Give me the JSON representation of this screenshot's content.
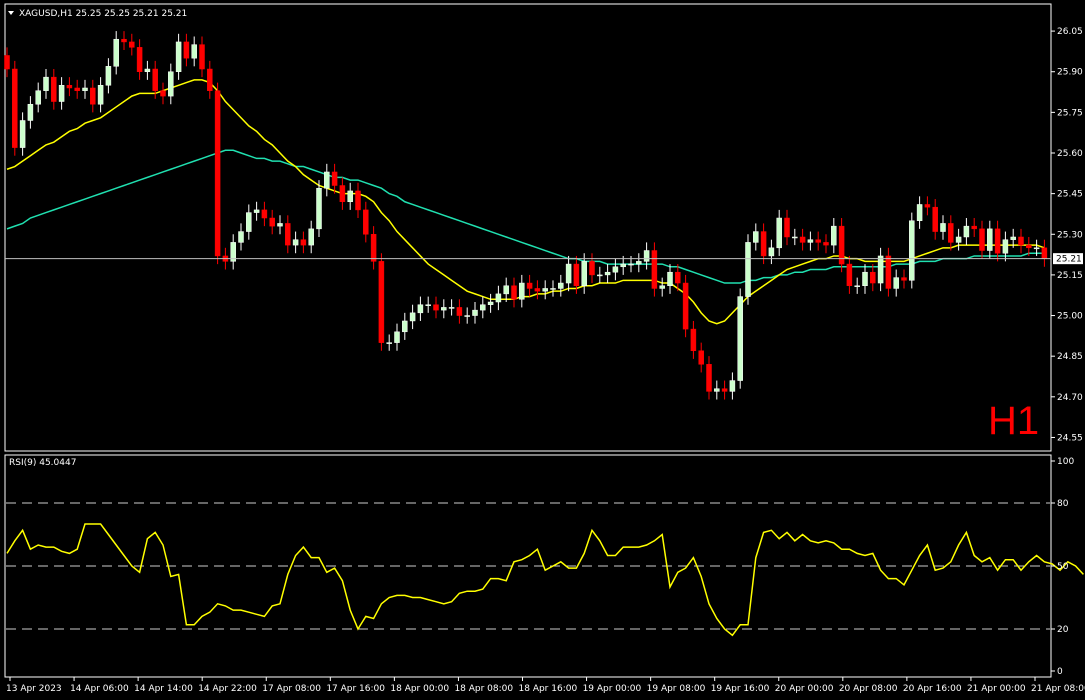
{
  "header": {
    "symbol_line": "XAGUSD,H1  25.25 25.25 25.21 25.21",
    "timeframe_label": "H1",
    "current_price_label": "25.21"
  },
  "colors": {
    "background": "#000000",
    "grid": "#ffffff",
    "bull_candle": "#ffffff",
    "bull_candle_fill": "#ccffcc",
    "bear_candle": "#ff0000",
    "fast_ma": "#ffff00",
    "slow_ma": "#20e0b0",
    "rsi_line": "#ffff00",
    "timeframe_text": "#ff0000"
  },
  "chart_data": [
    {
      "type": "candlestick",
      "symbol": "XAGUSD",
      "timeframe": "H1",
      "ylim": [
        24.5,
        26.15
      ],
      "y_ticks": [
        "26.05",
        "25.90",
        "25.75",
        "25.60",
        "25.45",
        "25.30",
        "25.15",
        "25.00",
        "24.85",
        "24.70",
        "24.55"
      ],
      "last_price": 25.21,
      "x_tick_labels": [
        "13 Apr 2023",
        "14 Apr 06:00",
        "14 Apr 14:00",
        "14 Apr 22:00",
        "17 Apr 08:00",
        "17 Apr 16:00",
        "18 Apr 00:00",
        "18 Apr 08:00",
        "18 Apr 16:00",
        "19 Apr 00:00",
        "19 Apr 08:00",
        "19 Apr 16:00",
        "20 Apr 00:00",
        "20 Apr 08:00",
        "20 Apr 16:00",
        "21 Apr 00:00",
        "21 Apr 08:00"
      ],
      "close": [
        25.91,
        25.62,
        25.72,
        25.78,
        25.83,
        25.88,
        25.79,
        25.85,
        25.84,
        25.83,
        25.84,
        25.78,
        25.85,
        25.92,
        26.02,
        26.01,
        25.99,
        25.9,
        25.91,
        25.83,
        25.81,
        25.9,
        26.01,
        25.95,
        26.0,
        25.91,
        25.83,
        25.22,
        25.2,
        25.27,
        25.31,
        25.38,
        25.39,
        25.36,
        25.33,
        25.34,
        25.26,
        25.28,
        25.26,
        25.32,
        25.47,
        25.53,
        25.48,
        25.42,
        25.46,
        25.39,
        25.3,
        25.2,
        24.9,
        24.9,
        24.94,
        24.98,
        25.01,
        25.04,
        25.04,
        25.02,
        25.03,
        25.03,
        25.0,
        25.0,
        25.02,
        25.04,
        25.05,
        25.08,
        25.11,
        25.06,
        25.12,
        25.1,
        25.09,
        25.1,
        25.1,
        25.12,
        25.19,
        25.11,
        25.2,
        25.15,
        25.15,
        25.16,
        25.18,
        25.19,
        25.19,
        25.2,
        25.24,
        25.1,
        25.11,
        25.16,
        25.12,
        24.95,
        24.87,
        24.82,
        24.72,
        24.73,
        24.72,
        24.76,
        25.07,
        25.27,
        25.31,
        25.22,
        25.25,
        25.36,
        25.29,
        25.29,
        25.27,
        25.28,
        25.27,
        25.26,
        25.33,
        25.19,
        25.11,
        25.11,
        25.16,
        25.12,
        25.22,
        25.1,
        25.14,
        25.13,
        25.35,
        25.41,
        25.4,
        25.31,
        25.34,
        25.27,
        25.29,
        25.33,
        25.32,
        25.24,
        25.32,
        25.23,
        25.28,
        25.29,
        25.26,
        25.25,
        25.25,
        25.21
      ],
      "series": [
        {
          "name": "fast_ma",
          "values": [
            25.54,
            25.55,
            25.57,
            25.59,
            25.61,
            25.63,
            25.64,
            25.66,
            25.68,
            25.69,
            25.71,
            25.72,
            25.73,
            25.75,
            25.77,
            25.79,
            25.81,
            25.82,
            25.82,
            25.82,
            25.83,
            25.84,
            25.85,
            25.86,
            25.87,
            25.87,
            25.86,
            25.83,
            25.79,
            25.76,
            25.73,
            25.7,
            25.68,
            25.65,
            25.63,
            25.6,
            25.57,
            25.55,
            25.52,
            25.5,
            25.48,
            25.47,
            25.46,
            25.45,
            25.45,
            25.45,
            25.44,
            25.42,
            25.38,
            25.35,
            25.31,
            25.28,
            25.25,
            25.22,
            25.19,
            25.17,
            25.15,
            25.13,
            25.11,
            25.09,
            25.08,
            25.07,
            25.06,
            25.06,
            25.06,
            25.06,
            25.07,
            25.07,
            25.08,
            25.08,
            25.09,
            25.09,
            25.1,
            25.1,
            25.11,
            25.11,
            25.12,
            25.12,
            25.12,
            25.13,
            25.13,
            25.13,
            25.13,
            25.13,
            25.12,
            25.12,
            25.1,
            25.08,
            25.05,
            25.01,
            24.98,
            24.97,
            24.98,
            25.01,
            25.04,
            25.07,
            25.09,
            25.11,
            25.13,
            25.15,
            25.17,
            25.18,
            25.19,
            25.2,
            25.21,
            25.21,
            25.22,
            25.22,
            25.21,
            25.21,
            25.2,
            25.2,
            25.2,
            25.2,
            25.2,
            25.2,
            25.21,
            25.22,
            25.23,
            25.24,
            25.25,
            25.25,
            25.26,
            25.26,
            25.26,
            25.26,
            25.26,
            25.26,
            25.26,
            25.26,
            25.26,
            25.26,
            25.26,
            25.25
          ]
        },
        {
          "name": "slow_ma",
          "values": [
            25.32,
            25.33,
            25.34,
            25.36,
            25.37,
            25.38,
            25.39,
            25.4,
            25.41,
            25.42,
            25.43,
            25.44,
            25.45,
            25.46,
            25.47,
            25.48,
            25.49,
            25.5,
            25.51,
            25.52,
            25.53,
            25.54,
            25.55,
            25.56,
            25.57,
            25.58,
            25.59,
            25.6,
            25.61,
            25.61,
            25.6,
            25.59,
            25.58,
            25.58,
            25.57,
            25.57,
            25.56,
            25.55,
            25.55,
            25.54,
            25.53,
            25.52,
            25.51,
            25.51,
            25.5,
            25.5,
            25.49,
            25.48,
            25.47,
            25.45,
            25.44,
            25.42,
            25.41,
            25.4,
            25.39,
            25.38,
            25.37,
            25.36,
            25.35,
            25.34,
            25.33,
            25.32,
            25.31,
            25.3,
            25.29,
            25.28,
            25.27,
            25.26,
            25.25,
            25.24,
            25.23,
            25.22,
            25.21,
            25.21,
            25.2,
            25.2,
            25.2,
            25.19,
            25.19,
            25.19,
            25.19,
            25.19,
            25.19,
            25.19,
            25.19,
            25.18,
            25.18,
            25.17,
            25.16,
            25.15,
            25.14,
            25.13,
            25.12,
            25.12,
            25.12,
            25.13,
            25.13,
            25.14,
            25.14,
            25.15,
            25.15,
            25.16,
            25.16,
            25.17,
            25.17,
            25.17,
            25.18,
            25.18,
            25.18,
            25.18,
            25.18,
            25.18,
            25.18,
            25.18,
            25.19,
            25.19,
            25.19,
            25.2,
            25.2,
            25.2,
            25.21,
            25.21,
            25.21,
            25.21,
            25.22,
            25.22,
            25.22,
            25.22,
            25.22,
            25.22,
            25.22,
            25.23,
            25.23,
            25.23
          ]
        }
      ]
    },
    {
      "type": "line",
      "indicator_label": "RSI(9) 45.0447",
      "ylim": [
        0,
        100
      ],
      "y_ticks": [
        "100",
        "80",
        "50",
        "20",
        "0"
      ],
      "levels": [
        80,
        50,
        20
      ],
      "values": [
        56,
        62,
        67,
        58,
        60,
        59,
        59,
        57,
        56,
        58,
        70,
        70,
        70,
        65,
        60,
        55,
        50,
        47,
        63,
        66,
        60,
        45,
        46,
        22,
        22,
        26,
        28,
        32,
        31,
        29,
        29,
        28,
        27,
        26,
        31,
        32,
        46,
        55,
        59,
        54,
        54,
        47,
        49,
        43,
        29,
        20,
        26,
        25,
        32,
        35,
        36,
        36,
        35,
        35,
        34,
        33,
        32,
        33,
        37,
        38,
        38,
        39,
        44,
        44,
        43,
        52,
        53,
        55,
        58,
        48,
        50,
        52,
        49,
        49,
        56,
        67,
        62,
        55,
        55,
        59,
        59,
        59,
        60,
        62,
        65,
        40,
        47,
        49,
        54,
        45,
        32,
        25,
        20,
        17,
        22,
        22,
        54,
        66,
        67,
        63,
        66,
        62,
        65,
        62,
        61,
        62,
        61,
        58,
        58,
        56,
        55,
        56,
        48,
        44,
        44,
        41,
        48,
        55,
        60,
        48,
        49,
        52,
        60,
        66,
        55,
        52,
        54,
        48,
        53,
        53,
        48,
        52,
        55,
        52,
        51,
        48,
        52,
        50,
        46
      ]
    }
  ]
}
